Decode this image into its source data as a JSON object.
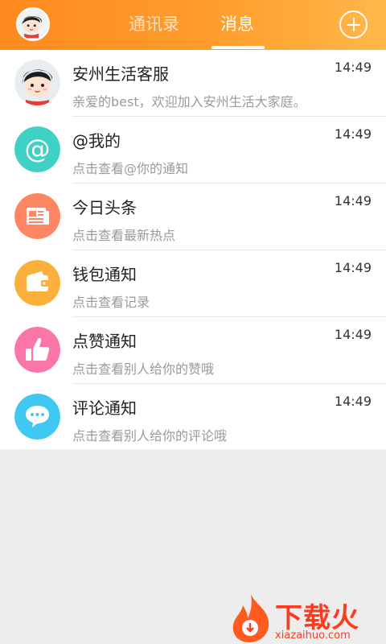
{
  "header": {
    "tabs": [
      {
        "label": "通讯录",
        "active": false
      },
      {
        "label": "消息",
        "active": true
      }
    ],
    "accent_colors": [
      "#ff8a1f",
      "#ffb84a"
    ]
  },
  "messages": [
    {
      "title": "安州生活客服",
      "subtitle": "亲爱的best，欢迎加入安州生活大家庭。",
      "time": "14:49",
      "icon": "cartoon-avatar-icon"
    },
    {
      "title": "@我的",
      "subtitle": "点击查看@你的通知",
      "time": "14:49",
      "icon": "at-sign-icon",
      "color": "#3fd2c4"
    },
    {
      "title": "今日头条",
      "subtitle": "点击查看最新热点",
      "time": "14:49",
      "icon": "newspaper-icon",
      "color": "#ff8662"
    },
    {
      "title": "钱包通知",
      "subtitle": "点击查看记录",
      "time": "14:49",
      "icon": "wallet-icon",
      "color": "#fbb03b"
    },
    {
      "title": "点赞通知",
      "subtitle": "点击查看别人给你的赞哦",
      "time": "14:49",
      "icon": "thumbs-up-icon",
      "color": "#fa76a6"
    },
    {
      "title": "评论通知",
      "subtitle": "点击查看别人给你的评论哦",
      "time": "14:49",
      "icon": "chat-bubble-icon",
      "color": "#3ec8f2"
    }
  ],
  "watermark": {
    "brand": "下载火",
    "domain": "xiazaihuo.com"
  }
}
